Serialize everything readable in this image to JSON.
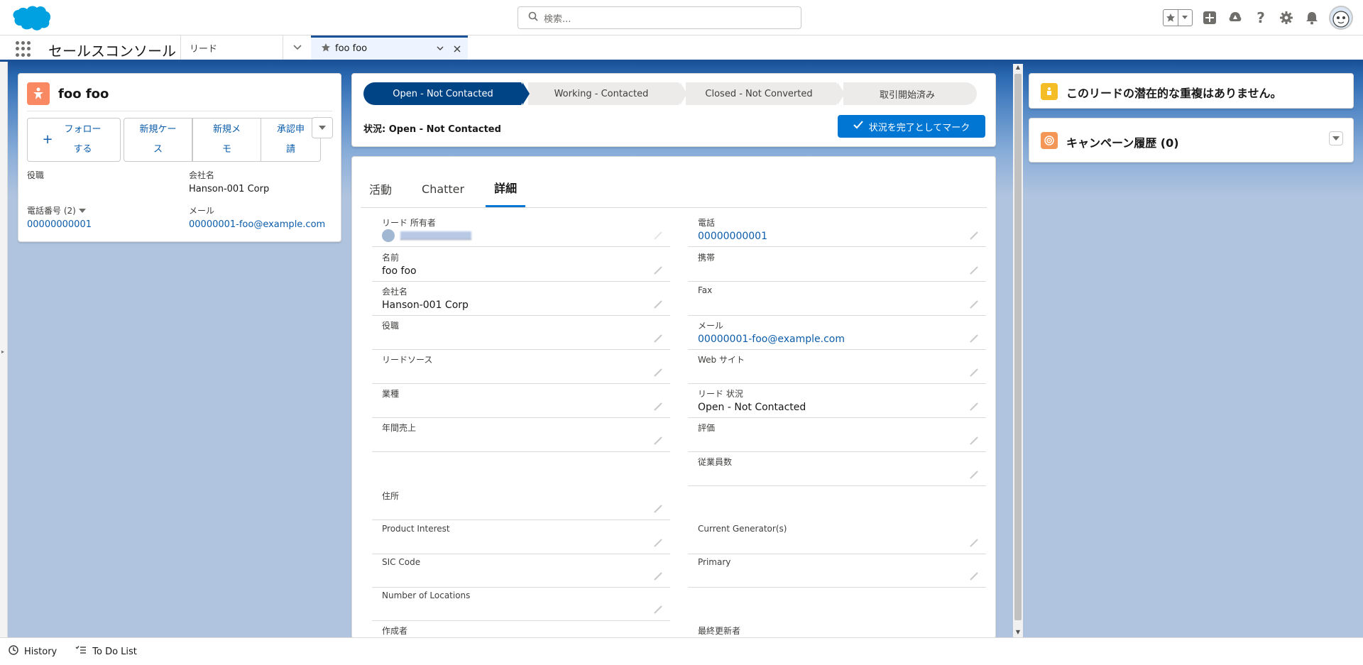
{
  "header": {
    "search_placeholder": "検索..."
  },
  "nav": {
    "app_name": "セールスコンソール",
    "object_item": "リード",
    "tab_label": "foo foo"
  },
  "highlights": {
    "title": "foo foo",
    "follow_button": "フォローする",
    "actions": [
      "新規ケース",
      "新規メモ",
      "承認申請"
    ],
    "fields": {
      "title_label": "役職",
      "title_value": "",
      "company_label": "会社名",
      "company_value": "Hanson-001 Corp",
      "phone_label": "電話番号 (2)",
      "phone_value": "00000000001",
      "email_label": "メール",
      "email_value": "00000001-foo@example.com"
    }
  },
  "path": {
    "steps": [
      "Open - Not Contacted",
      "Working - Contacted",
      "Closed - Not Converted",
      "取引開始済み"
    ],
    "status_text": "状況: Open - Not Contacted",
    "mark_button": "状況を完了としてマーク"
  },
  "detail": {
    "tabs": [
      "活動",
      "Chatter",
      "詳細"
    ],
    "active_tab": "詳細",
    "left_fields": [
      {
        "label": "リード 所有者",
        "value": ""
      },
      {
        "label": "名前",
        "value": "foo foo"
      },
      {
        "label": "会社名",
        "value": "Hanson-001 Corp"
      },
      {
        "label": "役職",
        "value": ""
      },
      {
        "label": "リードソース",
        "value": ""
      },
      {
        "label": "業種",
        "value": ""
      },
      {
        "label": "年間売上",
        "value": ""
      },
      {
        "label": "住所",
        "value": ""
      },
      {
        "label": "Product Interest",
        "value": ""
      },
      {
        "label": "SIC Code",
        "value": ""
      },
      {
        "label": "Number of Locations",
        "value": ""
      },
      {
        "label": "作成者",
        "value": ""
      }
    ],
    "right_fields": [
      {
        "label": "電話",
        "value": "00000000001"
      },
      {
        "label": "携帯",
        "value": ""
      },
      {
        "label": "Fax",
        "value": ""
      },
      {
        "label": "メール",
        "value": "00000001-foo@example.com"
      },
      {
        "label": "Web サイト",
        "value": ""
      },
      {
        "label": "リード 状況",
        "value": "Open - Not Contacted"
      },
      {
        "label": "評価",
        "value": ""
      },
      {
        "label": "従業員数",
        "value": ""
      },
      {
        "label": "Current Generator(s)",
        "value": ""
      },
      {
        "label": "Primary",
        "value": ""
      },
      {
        "label": "最終更新者",
        "value": ""
      }
    ]
  },
  "right_panel": {
    "duplicates_title": "このリードの潜在的な重複はありません。",
    "campaign_title": "キャンペーン履歴 (0)"
  },
  "utility_bar": {
    "history": "History",
    "todo": "To Do List"
  },
  "colors": {
    "brand": "#0176d3",
    "nav_accent": "#1b5297",
    "lead_icon": "#f88962",
    "link": "#0b5cab"
  }
}
